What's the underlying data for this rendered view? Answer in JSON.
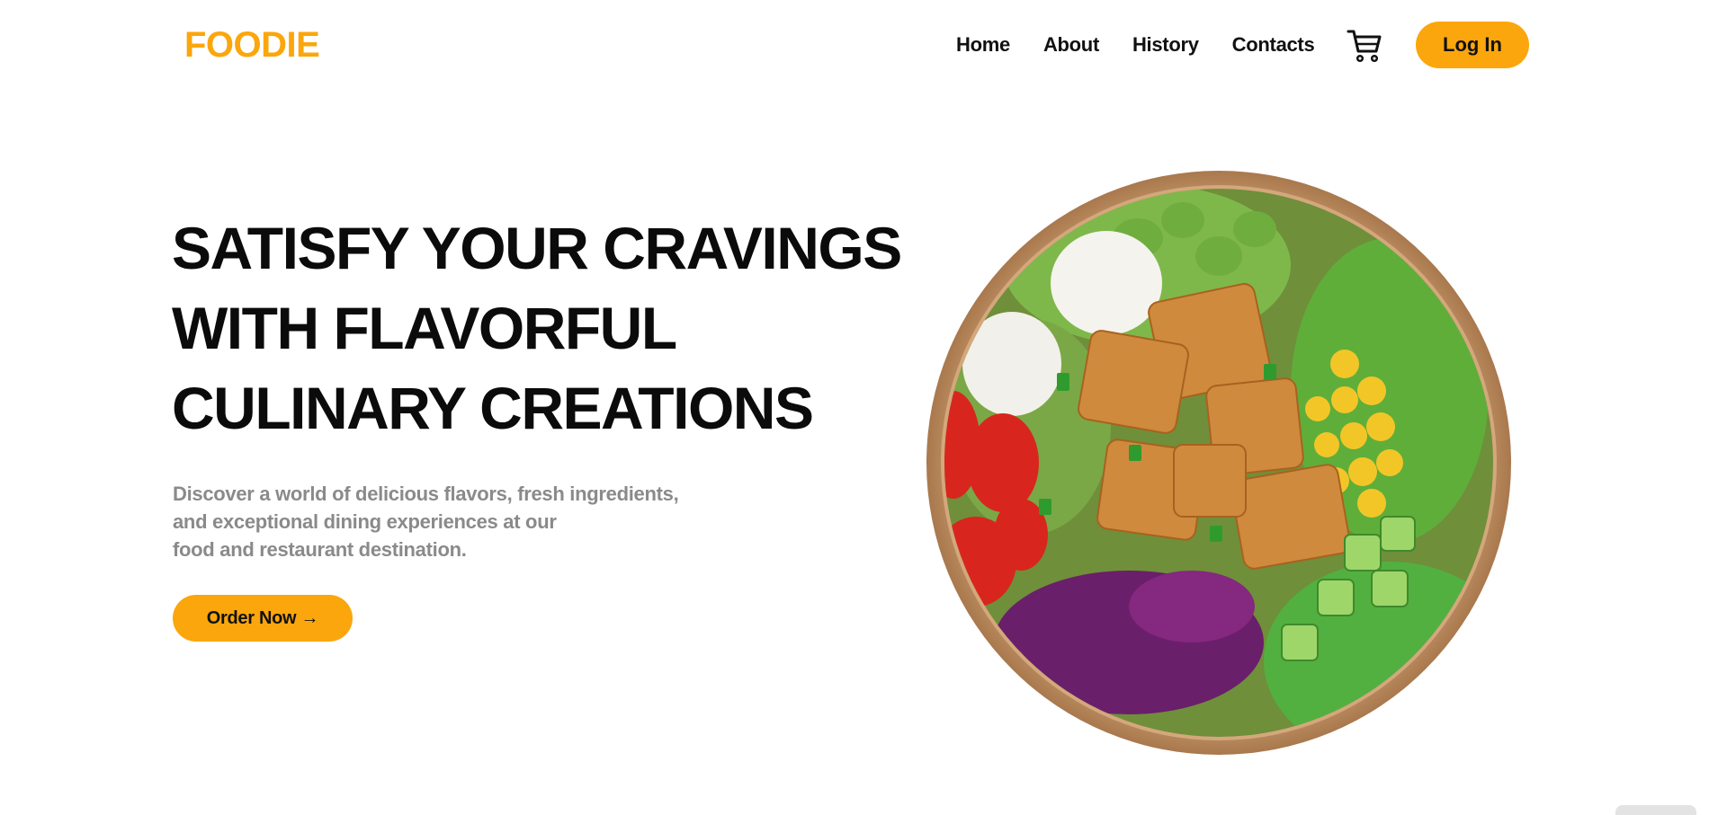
{
  "header": {
    "logo": "FOODIE",
    "nav": [
      "Home",
      "About",
      "History",
      "Contacts"
    ],
    "cart_icon": "shopping-cart-icon",
    "login_label": "Log In"
  },
  "hero": {
    "title_lines": [
      "SATISFY YOUR CRAVINGS",
      "WITH FLAVORFUL",
      "CULINARY CREATIONS"
    ],
    "description_lines": [
      "Discover a world of delicious flavors, fresh ingredients,",
      "and exceptional dining experiences at our",
      "food and restaurant destination."
    ],
    "cta_label": "Order Now →"
  },
  "colors": {
    "accent": "#FBA60C",
    "heading": "#0b0b0b",
    "muted_text": "#8a8a8a",
    "background": "#ffffff"
  }
}
